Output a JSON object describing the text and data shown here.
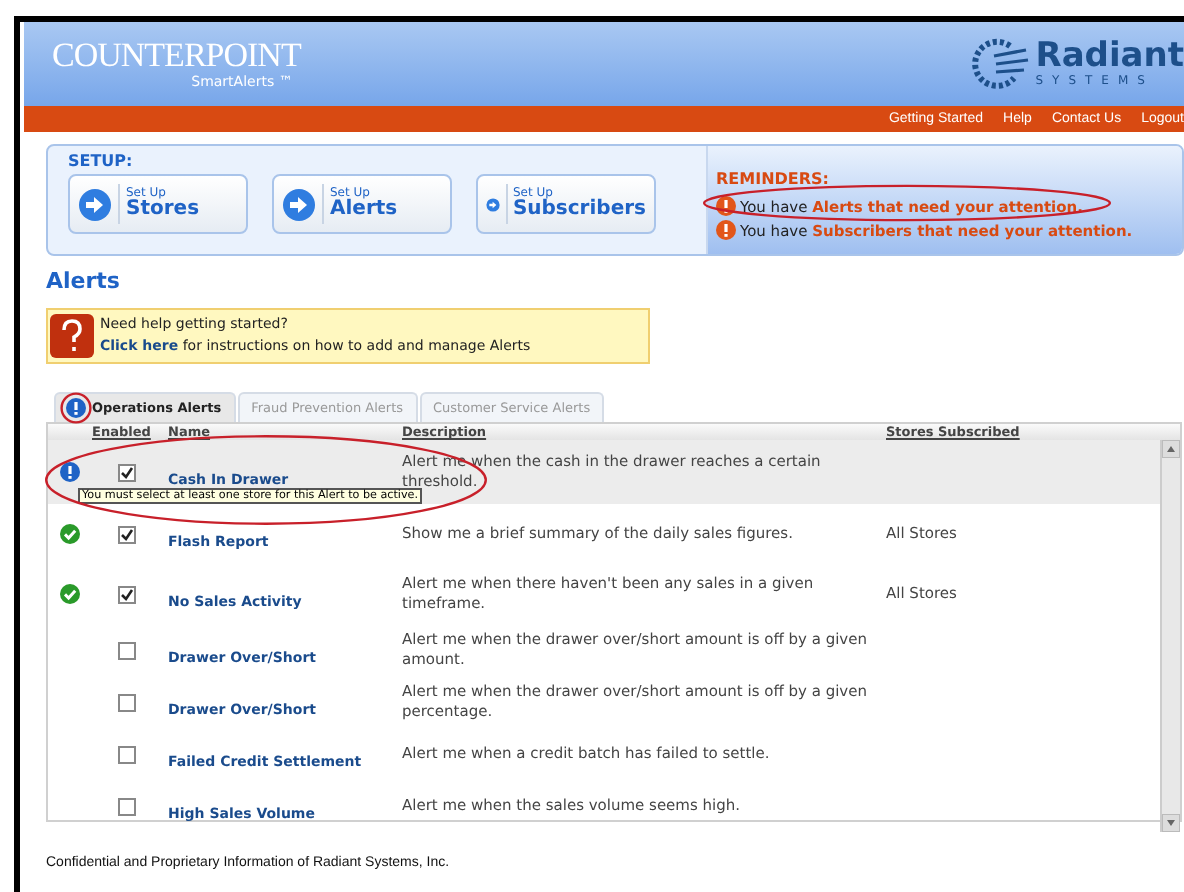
{
  "header": {
    "logo_title": "COUNTERPOINT",
    "logo_subtitle": "SmartAlerts ™",
    "brand": "Radiant",
    "brand_sub": "SYSTEMS"
  },
  "nav": [
    "Getting Started",
    "Help",
    "Contact Us",
    "Logout"
  ],
  "setup": {
    "title": "SETUP:",
    "buttons": [
      {
        "small": "Set Up",
        "label": "Stores"
      },
      {
        "small": "Set Up",
        "label": "Alerts"
      },
      {
        "small": "Set Up",
        "label": "Subscribers"
      }
    ]
  },
  "reminders": {
    "title": "REMINDERS:",
    "items": [
      "You have **Alerts that need your attention.**",
      "You have **Subscribers that need your attention.**"
    ]
  },
  "heading": "Alerts",
  "help": {
    "line1": "Need help getting started?",
    "link": "Click here",
    "rest": "for instructions on how to add and manage Alerts"
  },
  "tabs": [
    {
      "label": "Operations Alerts",
      "selected": true
    },
    {
      "label": "Fraud Prevention Alerts",
      "selected": false
    },
    {
      "label": "Customer Service Alerts",
      "selected": false
    }
  ],
  "table": {
    "columns": [
      "Enabled",
      "Name",
      "Description",
      "Stores Subscribed"
    ],
    "rows": [
      {
        "kind": "info",
        "enabled": true,
        "selected": true,
        "name": "Cash In Drawer",
        "description": "Alert me when the cash in the drawer reaches a certain threshold."
      },
      {
        "kind": "ok",
        "enabled": true,
        "selected": false,
        "name": "Flash Report",
        "description": "Show me a brief summary of the daily sales figures.",
        "stores": "All Stores"
      },
      {
        "kind": "ok",
        "enabled": true,
        "selected": false,
        "name": "No Sales Activity",
        "description": "Alert me when there haven't been any sales in a given timeframe.",
        "stores": "All Stores"
      },
      {
        "kind": "plain",
        "enabled": false,
        "selected": false,
        "name": "Drawer Over/Short",
        "description": "Alert me when the drawer over/short amount is off by a given amount."
      },
      {
        "kind": "plain",
        "enabled": false,
        "selected": false,
        "name": "Drawer Over/Short",
        "description": "Alert me when the drawer over/short amount is off by a given percentage."
      },
      {
        "kind": "plain",
        "enabled": false,
        "selected": false,
        "name": "Failed Credit Settlement",
        "description": "Alert me when a credit batch has failed to settle."
      },
      {
        "kind": "plain",
        "enabled": false,
        "selected": false,
        "name": "High Sales Volume",
        "description": "Alert me when the sales volume seems high."
      }
    ]
  },
  "tooltip": "You must select at least one store for this Alert to be active.",
  "footer": "Confidential and Proprietary Information of Radiant Systems, Inc."
}
